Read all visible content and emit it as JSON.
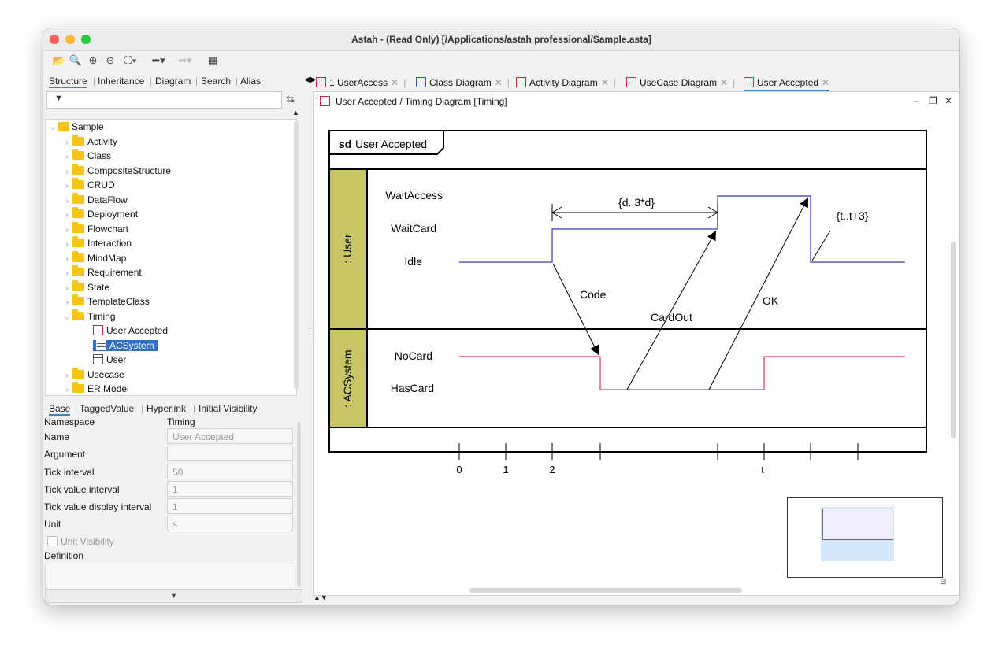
{
  "window": {
    "title": "Astah - (Read Only) [/Applications/astah professional/Sample.asta]"
  },
  "toolbar": {
    "icons": [
      "open-folder-icon",
      "zoom-fit-icon",
      "zoom-in-icon",
      "zoom-out-icon",
      "fit-window-icon",
      "back-icon",
      "forward-icon",
      "grid-icon"
    ]
  },
  "left_tabs": [
    "Structure",
    "Inheritance",
    "Diagram",
    "Search",
    "Alias"
  ],
  "tree": {
    "root": "Sample",
    "items": [
      "Activity",
      "Class",
      "CompositeStructure",
      "CRUD",
      "DataFlow",
      "Deployment",
      "Flowchart",
      "Interaction",
      "MindMap",
      "Requirement",
      "State",
      "TemplateClass",
      "Timing"
    ],
    "timing_children": [
      "User Accepted",
      "ACSystem",
      "User"
    ],
    "after": [
      "Usecase",
      "ER Model"
    ]
  },
  "prop_tabs": [
    "Base",
    "TaggedValue",
    "Hyperlink",
    "Initial Visibility"
  ],
  "properties": {
    "namespace_label": "Namespace",
    "namespace_value": "Timing",
    "name_label": "Name",
    "name_value": "User Accepted",
    "argument_label": "Argument",
    "argument_value": "",
    "tick_interval_label": "Tick interval",
    "tick_interval_value": "50",
    "tick_value_interval_label": "Tick value interval",
    "tick_value_interval_value": "1",
    "tick_display_label": "Tick value display interval",
    "tick_display_value": "1",
    "unit_label": "Unit",
    "unit_value": "s",
    "unit_visibility_label": "Unit Visibility",
    "definition_label": "Definition"
  },
  "editor_tabs": [
    "1 UserAccess",
    "Class Diagram",
    "Activity Diagram",
    "UseCase Diagram",
    "User Accepted"
  ],
  "editor": {
    "title": "User Accepted / Timing Diagram [Timing]"
  },
  "diagram": {
    "frame_keyword": "sd",
    "frame_name": "User Accepted",
    "lifeline_user": ": User",
    "lifeline_acsystem": ": ACSystem",
    "user_states": [
      "WaitAccess",
      "WaitCard",
      "Idle"
    ],
    "acsystem_states": [
      "NoCard",
      "HasCard"
    ],
    "constraint_duration": "{d..3*d}",
    "constraint_time": "{t..t+3}",
    "messages": [
      "Code",
      "CardOut",
      "OK"
    ],
    "ticks": [
      "0",
      "1",
      "2",
      "t"
    ],
    "colors": {
      "user_line": "#3333cc",
      "acsystem_line": "#e0336a",
      "lifeline_fill": "#c8c566"
    }
  }
}
